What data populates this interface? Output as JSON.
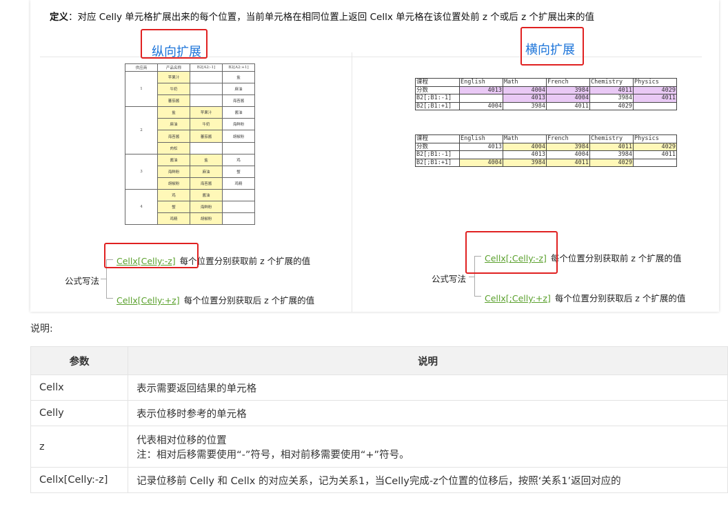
{
  "definition": {
    "label": "定义",
    "text": "：对应 Celly 单元格扩展出来的每个位置，当前单元格在相同位置上返回 Cellx 单元格在该位置处前 z 个或后 z 个扩展出来的值"
  },
  "vertical": {
    "heading": "纵向扩展",
    "table": {
      "headers": [
        "供应商",
        "产品名称",
        "B2[A2:-1]",
        "B2[A2:+1]"
      ],
      "groups": [
        {
          "id": "1",
          "rows": [
            [
              "苹果汁",
              "",
              "盐"
            ],
            [
              "牛奶",
              "",
              "麻油"
            ],
            [
              "蕃茄酱",
              "",
              "海苔酱"
            ]
          ]
        },
        {
          "id": "2",
          "rows": [
            [
              "盐",
              "苹果汁",
              "酱油"
            ],
            [
              "麻油",
              "牛奶",
              "海鲜粉"
            ],
            [
              "海苔酱",
              "蕃茄酱",
              "胡椒粉"
            ],
            [
              "肉松",
              "",
              ""
            ]
          ]
        },
        {
          "id": "3",
          "rows": [
            [
              "酱油",
              "盐",
              "鸡"
            ],
            [
              "海鲜粉",
              "麻油",
              "蟹"
            ],
            [
              "胡椒粉",
              "海苔酱",
              "鸡精"
            ]
          ]
        },
        {
          "id": "4",
          "rows": [
            [
              "鸡",
              "酱油",
              ""
            ],
            [
              "蟹",
              "海鲜粉",
              ""
            ],
            [
              "鸡精",
              "胡椒粉",
              ""
            ]
          ]
        }
      ]
    },
    "formula_label": "公式写法",
    "formulas": [
      {
        "code": "Cellx[Celly:-z]",
        "desc": "每个位置分别获取前 z 个扩展的值"
      },
      {
        "code": "Cellx[Celly:+z]",
        "desc": "每个位置分别获取后 z 个扩展的值"
      }
    ]
  },
  "horizontal": {
    "heading": "横向扩展",
    "tables": [
      {
        "rows": [
          [
            "课程",
            "English",
            "Math",
            "French",
            "Chemistry",
            "Physics"
          ],
          [
            "分数",
            "4013",
            "4004",
            "3984",
            "4011",
            "4029"
          ],
          [
            "B2[;B1:-1]",
            "",
            "4013",
            "4004",
            "3984",
            "4011"
          ],
          [
            "B2[;B1:+1]",
            "4004",
            "3984",
            "4011",
            "4029",
            ""
          ]
        ]
      },
      {
        "rows": [
          [
            "课程",
            "English",
            "Math",
            "French",
            "Chemistry",
            "Physics"
          ],
          [
            "分数",
            "4013",
            "4004",
            "3984",
            "4011",
            "4029"
          ],
          [
            "B2[;B1:-1]",
            "",
            "4013",
            "4004",
            "3984",
            "4011"
          ],
          [
            "B2[;B1:+1]",
            "4004",
            "3984",
            "4011",
            "4029",
            ""
          ]
        ]
      }
    ],
    "formula_label": "公式写法",
    "formulas": [
      {
        "code": "Cellx[;Celly:-z]",
        "desc": "每个位置分别获取前 z 个扩展的值"
      },
      {
        "code": "Cellx[;Celly:+z]",
        "desc": "每个位置分别获取后 z 个扩展的值"
      }
    ]
  },
  "note_label": "说明:",
  "params": {
    "headers": [
      "参数",
      "说明"
    ],
    "rows": [
      {
        "key": "Cellx",
        "lines": [
          "表示需要返回结果的单元格"
        ]
      },
      {
        "key": "Celly",
        "lines": [
          "表示位移时参考的单元格"
        ]
      },
      {
        "key": "z",
        "lines": [
          "代表相对位移的位置",
          "注：相对后移需要使用“-”符号，相对前移需要使用“+”符号。"
        ]
      },
      {
        "key": "Cellx[Celly:-z]",
        "lines": [
          "记录位移前 Celly 和 Cellx 的对应关系，记为关系1，当Celly完成-z个位置的位移后，按照‘关系1’返回对应的"
        ]
      }
    ]
  }
}
